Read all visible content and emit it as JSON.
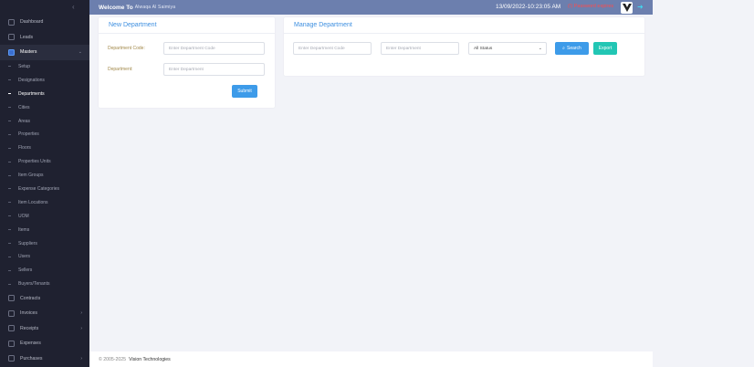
{
  "sidebar": {
    "collapse_icon": "chevron-left-icon",
    "items_top": [
      {
        "label": "Dashboard",
        "icon": "dashboard-icon"
      },
      {
        "label": "Leads",
        "icon": "leads-icon"
      },
      {
        "label": "Masters",
        "icon": "masters-icon",
        "active": true,
        "caret": "⌄"
      }
    ],
    "masters_sub": [
      "Setup",
      "Designations",
      "Departments",
      "Cities",
      "Areas",
      "Properties",
      "Floors",
      "Properties Units",
      "Item Groups",
      "Expense Categories",
      "Item Locations",
      "UOM",
      "Items",
      "Suppliers",
      "Users",
      "Sellers",
      "Buyers/Tenants"
    ],
    "active_sub": "Departments",
    "items_bottom": [
      {
        "label": "Contracts",
        "icon": "contracts-icon"
      },
      {
        "label": "Invoices",
        "icon": "invoices-icon",
        "caret": "›"
      },
      {
        "label": "Receipts",
        "icon": "receipts-icon",
        "caret": "›"
      },
      {
        "label": "Expenses",
        "icon": "expenses-icon"
      },
      {
        "label": "Purchases",
        "icon": "purchases-icon",
        "caret": "›"
      }
    ]
  },
  "header": {
    "welcome": "Welcome To",
    "user": "Alwaqa Al Saimiya",
    "datetime": "13/09/2022-10:23:05 AM",
    "alert": "(!) Password expires",
    "logo_icon": "vision-logo-icon",
    "logout_icon": "logout-icon"
  },
  "new_department": {
    "title": "New Department",
    "code_label": "Department Code:",
    "code_placeholder": "Enter Department Code",
    "name_label": "Department:",
    "name_placeholder": "Enter Department",
    "submit": "Submit"
  },
  "manage_department": {
    "title": "Manage Department",
    "code_placeholder": "Enter Department Code",
    "name_placeholder": "Enter Department",
    "status_selected": "All Status",
    "search_label": "Search",
    "search_icon": "search-icon",
    "export_label": "Export"
  },
  "footer": {
    "copyright": "© 2005-2025",
    "brand": "Vision Technologies"
  },
  "colors": {
    "sidebar_bg": "#1f2130",
    "header_bg": "#6c7fae",
    "accent_blue": "#3d9be9",
    "accent_teal": "#22c6b4",
    "title_blue": "#3d8fe0",
    "label_gold": "#a2894a",
    "alert_red": "#ff4b4b"
  }
}
